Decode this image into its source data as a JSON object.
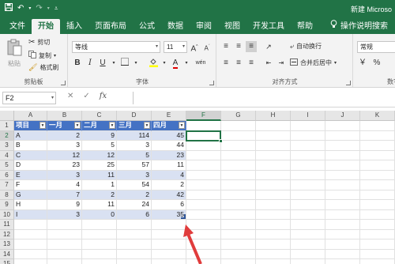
{
  "window": {
    "title": "新建 Microso"
  },
  "tabs": [
    "文件",
    "开始",
    "插入",
    "页面布局",
    "公式",
    "数据",
    "审阅",
    "视图",
    "开发工具",
    "帮助"
  ],
  "tell_me": "操作说明搜索",
  "ribbon": {
    "clipboard": {
      "label": "剪贴板",
      "paste": "粘贴",
      "cut": "剪切",
      "copy": "复制",
      "format_painter": "格式刷"
    },
    "font": {
      "label": "字体",
      "font_name": "等线",
      "font_size": "11",
      "bold": "B",
      "italic": "I",
      "underline": "U",
      "grow": "A",
      "shrink": "A",
      "font_color_glyph": "A",
      "wen": "wén"
    },
    "alignment": {
      "label": "对齐方式",
      "wrap_text": "自动换行",
      "merge_center": "合并后居中"
    },
    "number": {
      "label": "数字",
      "format": "常规"
    }
  },
  "formula_bar": {
    "name_box": "F2",
    "fx": "fx",
    "cancel": "✕",
    "enter": "✓",
    "content": ""
  },
  "sheet": {
    "columns": [
      "A",
      "B",
      "C",
      "D",
      "E",
      "F",
      "G",
      "H",
      "I",
      "J",
      "K"
    ],
    "selected_column": "F",
    "row_numbers": [
      "1",
      "2",
      "3",
      "4",
      "5",
      "6",
      "7",
      "8",
      "9",
      "10",
      "11",
      "12",
      "13",
      "14",
      "15"
    ],
    "active_cell": "F2",
    "table": {
      "headers": [
        "项目",
        "一月",
        "二月",
        "三月",
        "四月"
      ],
      "rows": [
        [
          "A",
          "2",
          "9",
          "114",
          "45"
        ],
        [
          "B",
          "3",
          "5",
          "3",
          "44"
        ],
        [
          "C",
          "12",
          "12",
          "5",
          "23"
        ],
        [
          "D",
          "23",
          "25",
          "57",
          "11"
        ],
        [
          "E",
          "3",
          "11",
          "3",
          "4"
        ],
        [
          "F",
          "4",
          "1",
          "54",
          "2"
        ],
        [
          "G",
          "7",
          "2",
          "2",
          "42"
        ],
        [
          "H",
          "9",
          "11",
          "24",
          "6"
        ],
        [
          "I",
          "3",
          "0",
          "6",
          "35"
        ]
      ]
    }
  },
  "colors": {
    "excel_green": "#217346",
    "table_header": "#4472c4",
    "table_band": "#d9e1f2",
    "arrow": "#e03c3c"
  },
  "icons": [
    "save-icon",
    "undo-icon",
    "redo-icon",
    "customize-icon",
    "lightbulb-icon",
    "paste-icon",
    "cut-icon",
    "copy-icon",
    "format-painter-icon",
    "filter-dropdown-icon",
    "red-arrow-annotation"
  ]
}
